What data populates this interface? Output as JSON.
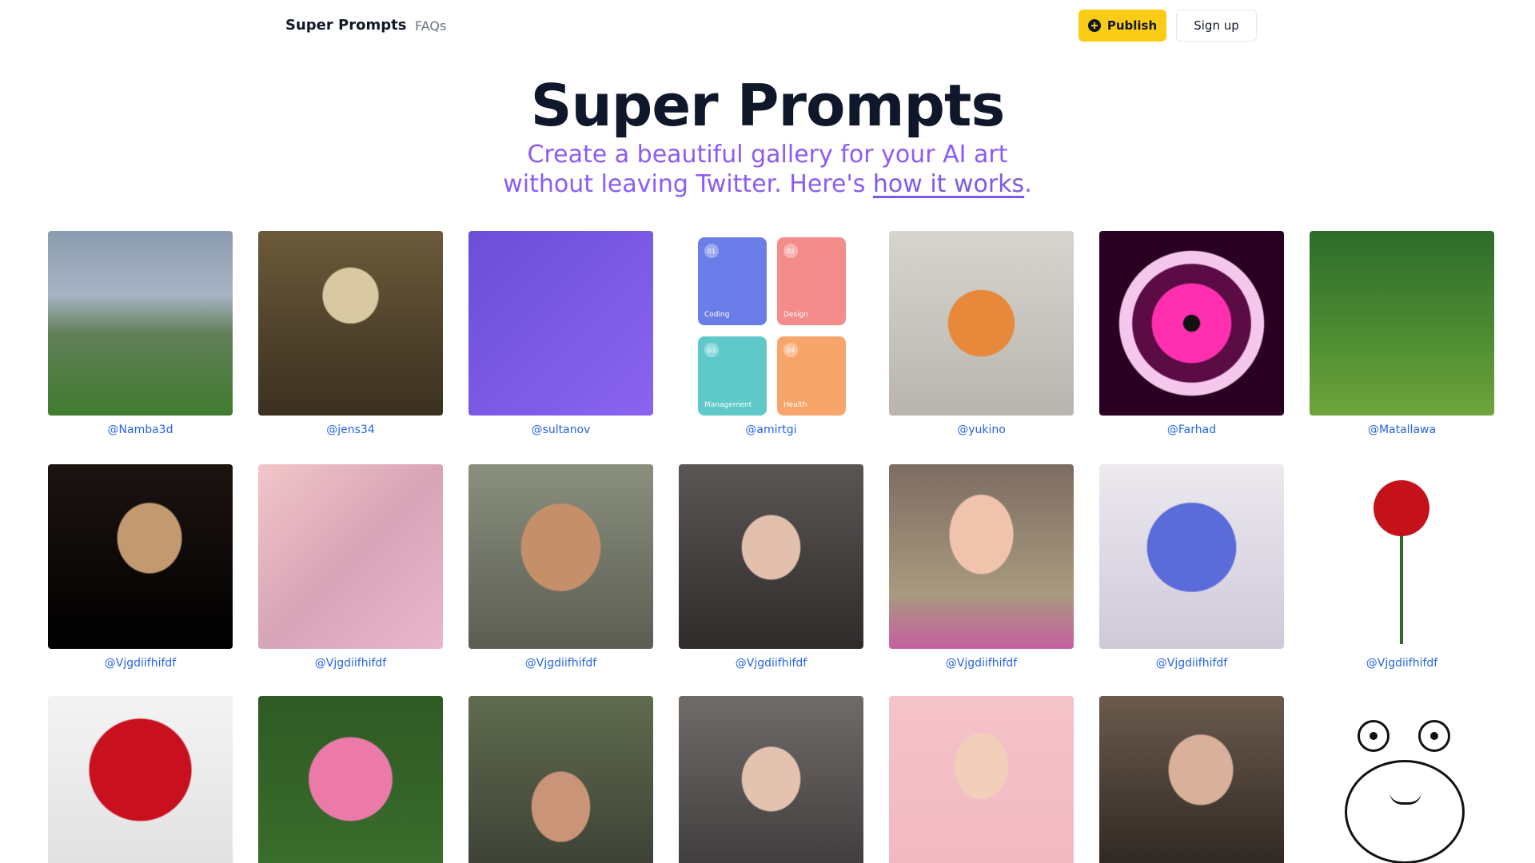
{
  "nav": {
    "brand": "Super Prompts",
    "faqs": "FAQs",
    "publish_label": "Publish",
    "signup_label": "Sign up"
  },
  "hero": {
    "title": "Super Prompts",
    "subtitle_line1": "Create a beautiful gallery for your AI art",
    "subtitle_line2_pre": "without leaving Twitter. Here's ",
    "subtitle_link": "how it works",
    "subtitle_post": "."
  },
  "gallery": {
    "row1": [
      {
        "handle": "@Namba3d"
      },
      {
        "handle": "@jens34"
      },
      {
        "handle": "@sultanov"
      },
      {
        "handle": "@amirtgi"
      },
      {
        "handle": "@yukino"
      },
      {
        "handle": "@Farhad"
      },
      {
        "handle": "@Matallawa"
      }
    ],
    "row2": [
      {
        "handle": "@Vjgdiifhifdf"
      },
      {
        "handle": "@Vjgdiifhifdf"
      },
      {
        "handle": "@Vjgdiifhifdf"
      },
      {
        "handle": "@Vjgdiifhifdf"
      },
      {
        "handle": "@Vjgdiifhifdf"
      },
      {
        "handle": "@Vjgdiifhifdf"
      },
      {
        "handle": "@Vjgdiifhifdf"
      }
    ],
    "cards_mock": {
      "c1_label": "Coding",
      "c2_label": "Design",
      "c3_label": "Management",
      "c4_label": "Health",
      "n1": "01",
      "n2": "02",
      "n3": "03",
      "n4": "04"
    }
  }
}
